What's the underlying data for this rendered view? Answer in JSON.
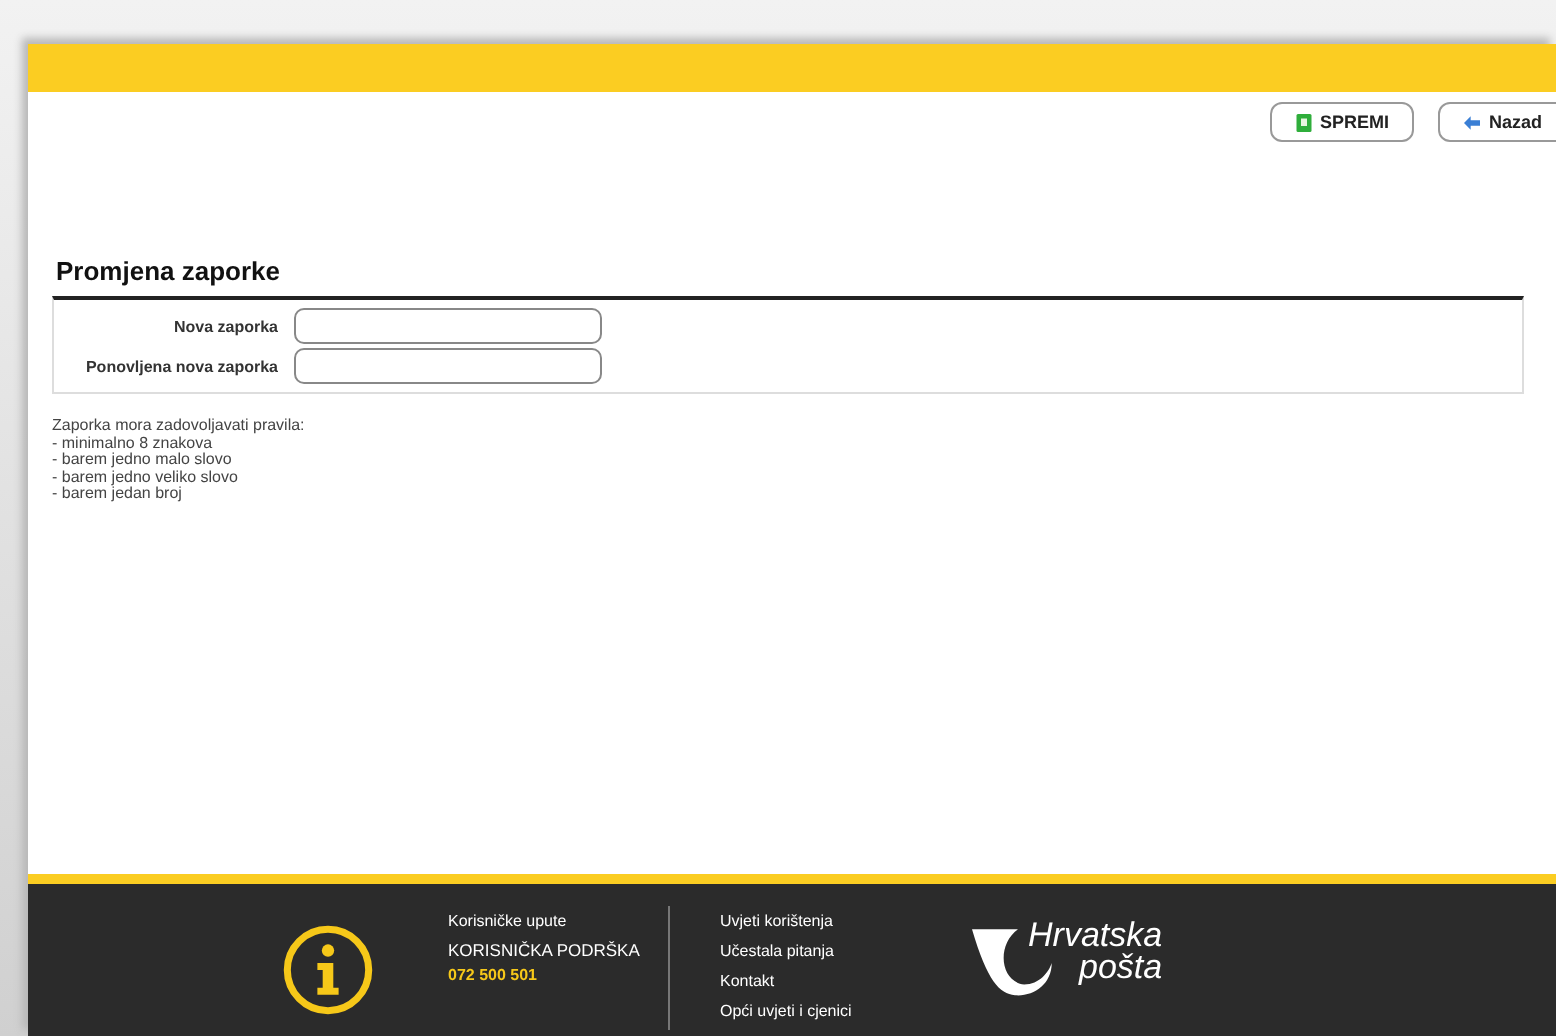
{
  "toolbar": {
    "buttons": [
      {
        "kind": "save",
        "label": "SPREMI"
      },
      {
        "kind": "back",
        "label": "Nazad"
      }
    ]
  },
  "form": {
    "title": "Promjena zaporke",
    "fields": [
      {
        "label": "Nova zaporka"
      },
      {
        "label": "Ponovljena nova zaporka"
      }
    ],
    "rules": [
      "Zaporka mora zadovoljavati pravila:",
      "- minimalno 8 znakova",
      "- barem jedno malo slovo",
      "- barem jedno veliko slovo",
      "- barem jedan broj"
    ]
  },
  "footer": {
    "help_link": "Korisničke upute",
    "support_label": "KORISNIČKA PODRŠKA",
    "support_phone": "072 500 501",
    "links": [
      "Uvjeti korištenja",
      "Učestala pitanja",
      "Kontakt",
      "Opći uvjeti i cjenici"
    ],
    "logo_lines": [
      "Hrvatska",
      "pošta"
    ]
  }
}
